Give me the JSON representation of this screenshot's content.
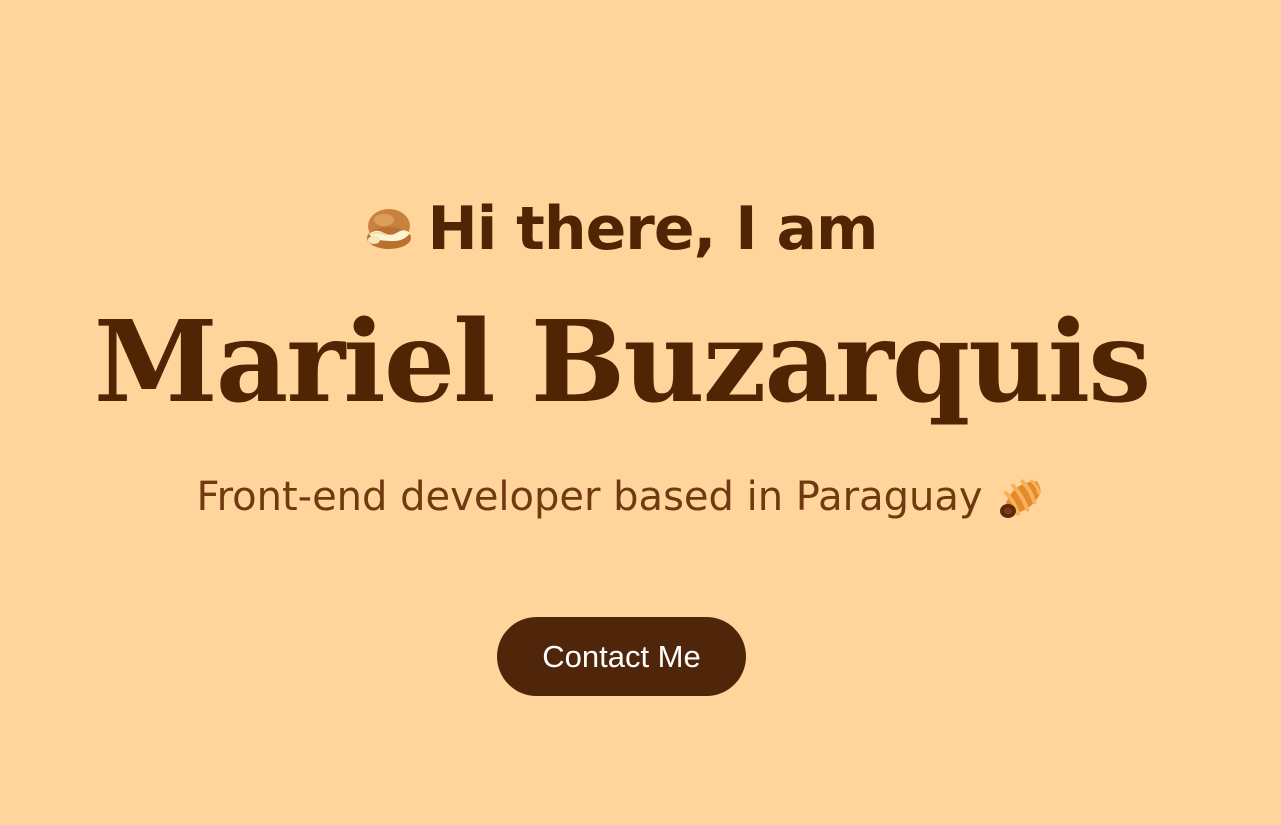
{
  "hero": {
    "greeting": "Hi there, I am",
    "greeting_icon": "cream-puff-icon",
    "name": "Mariel Buzarquis",
    "tagline": "Front-end developer based in Paraguay",
    "tagline_icon": "croissant-icon",
    "contact_button_label": "Contact Me"
  },
  "colors": {
    "background": "#FFD59B",
    "text_primary": "#4F2504",
    "text_secondary": "#70390F",
    "button_background": "#50260A",
    "button_text": "#FFFFFF"
  }
}
